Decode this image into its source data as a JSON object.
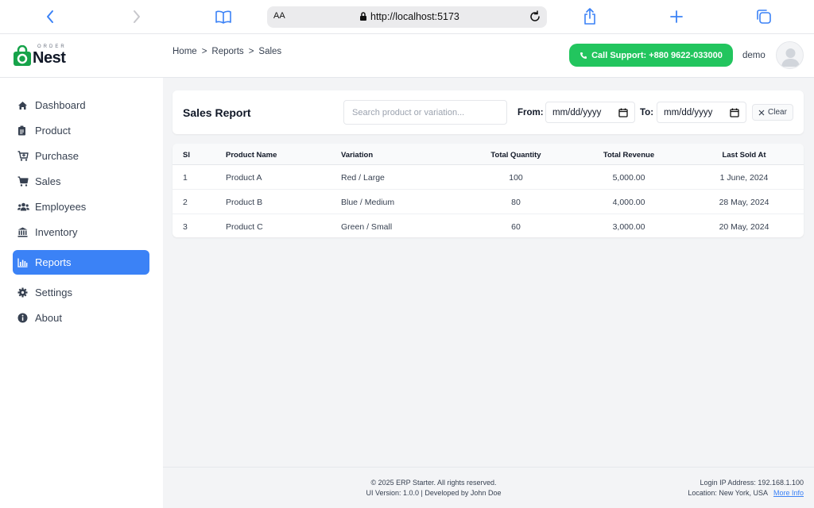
{
  "browser": {
    "aa_label": "AA",
    "url": "http://localhost:5173"
  },
  "app": {
    "logo_small": "ORDER",
    "logo_big": "Nest",
    "breadcrumb": [
      "Home",
      ">",
      "Reports",
      ">",
      "Sales"
    ],
    "support_label": "Call Support: +880 9622-033000",
    "username": "demo"
  },
  "sidebar": {
    "items": [
      {
        "label": "Dashboard",
        "icon": "home-icon"
      },
      {
        "label": "Product",
        "icon": "clipboard-icon"
      },
      {
        "label": "Purchase",
        "icon": "cart-plus-icon"
      },
      {
        "label": "Sales",
        "icon": "cart-icon"
      },
      {
        "label": "Employees",
        "icon": "users-icon"
      },
      {
        "label": "Inventory",
        "icon": "bank-icon"
      },
      {
        "label": "Reports",
        "icon": "chart-icon",
        "active": true
      },
      {
        "label": "Settings",
        "icon": "gear-icon"
      },
      {
        "label": "About",
        "icon": "info-icon"
      }
    ],
    "active_color": "#3b82f6"
  },
  "report": {
    "title": "Sales Report",
    "search_placeholder": "Search product or variation...",
    "from_label": "From:",
    "to_label": "To:",
    "from_value": "mm/dd/yyyy",
    "to_value": "mm/dd/yyyy",
    "clear_label": "Clear"
  },
  "table": {
    "headers": [
      "Sl",
      "Product Name",
      "Variation",
      "Total Quantity",
      "Total Revenue",
      "Last Sold At"
    ],
    "rows": [
      [
        "1",
        "Product A",
        "Red / Large",
        "100",
        "5,000.00",
        "1 June, 2024"
      ],
      [
        "2",
        "Product B",
        "Blue / Medium",
        "80",
        "4,000.00",
        "28 May, 2024"
      ],
      [
        "3",
        "Product C",
        "Green / Small",
        "60",
        "3,000.00",
        "20 May, 2024"
      ]
    ]
  },
  "footer": {
    "copyright": "© 2025 ERP Starter. All rights reserved.",
    "version": "UI Version: 1.0.0 | Developed by John Doe",
    "login_ip": "Login IP Address: 192.168.1.100",
    "location": "Location: New York, USA",
    "more_info": "More Info"
  },
  "colors": {
    "accent": "#3b82f6",
    "support_green": "#22c55e",
    "logo_green": "#16a34a"
  }
}
